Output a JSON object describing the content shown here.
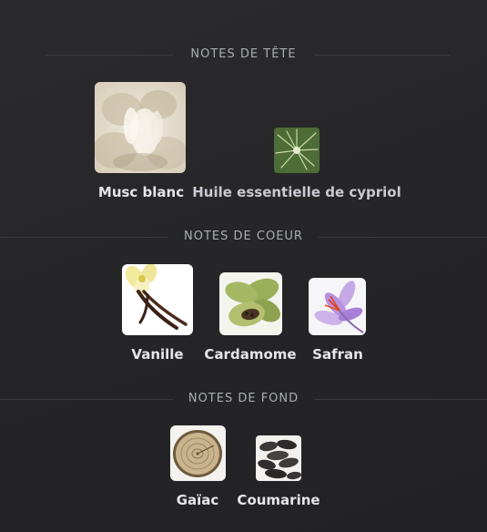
{
  "sections": [
    {
      "title": "NOTES DE TÊTE",
      "items": [
        {
          "label": "Musc blanc",
          "image": "white-musk-photo"
        },
        {
          "label": "Huile essentielle de cypriol",
          "image": "cypriol-plant-photo"
        }
      ]
    },
    {
      "title": "NOTES DE COEUR",
      "items": [
        {
          "label": "Vanille",
          "image": "vanilla-photo"
        },
        {
          "label": "Cardamome",
          "image": "cardamom-photo"
        },
        {
          "label": "Safran",
          "image": "saffron-photo"
        }
      ]
    },
    {
      "title": "NOTES DE FOND",
      "items": [
        {
          "label": "Gaïac",
          "image": "guaiac-wood-photo"
        },
        {
          "label": "Coumarine",
          "image": "tonka-bean-photo"
        }
      ]
    }
  ],
  "colors": {
    "background": "#252528",
    "header_text": "#a9acb3",
    "label_text": "#e6e6e8",
    "divider": "#3a3a3e"
  }
}
